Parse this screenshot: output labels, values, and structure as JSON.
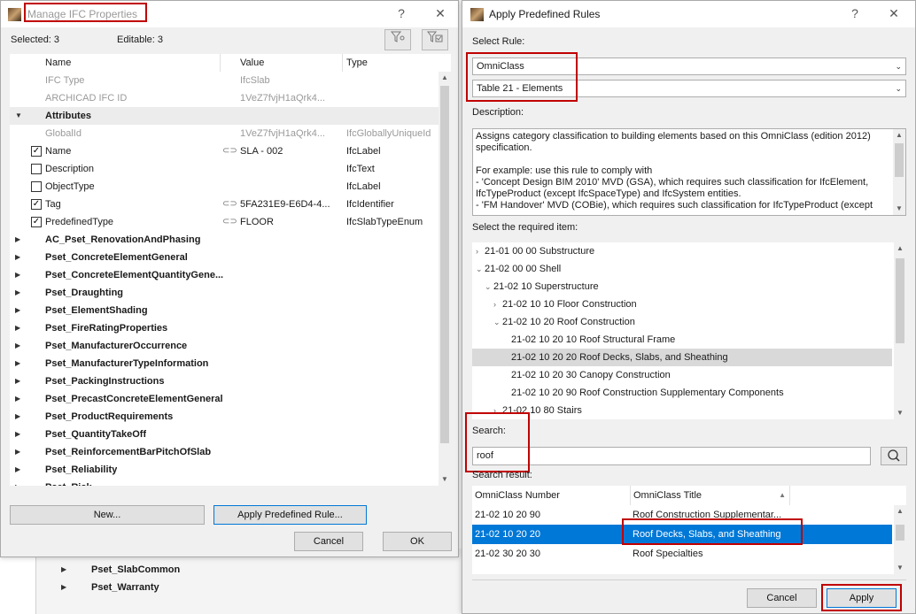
{
  "background_panel": {
    "rows": [
      "Pset_SlabCommon",
      "Pset_Warranty"
    ]
  },
  "left_dialog": {
    "title": "Manage IFC Properties",
    "help_label": "?",
    "close_label": "✕",
    "selected_label": "Selected: 3",
    "editable_label": "Editable: 3",
    "columns": {
      "name": "Name",
      "value": "Value",
      "type": "Type"
    },
    "top_rows": [
      {
        "name": "IFC Type",
        "value": "IfcSlab",
        "type": ""
      },
      {
        "name": "ARCHICAD IFC ID",
        "value": "1VeZ7fvjH1aQrk4...",
        "type": ""
      }
    ],
    "attributes_label": "Attributes",
    "attribute_rows": [
      {
        "name": "GlobalId",
        "value": "1VeZ7fvjH1aQrk4...",
        "type": "IfcGloballyUniqueId",
        "checked": null,
        "linked": false
      },
      {
        "name": "Name",
        "value": "SLA - 002",
        "type": "IfcLabel",
        "checked": true,
        "linked": true
      },
      {
        "name": "Description",
        "value": "",
        "type": "IfcText",
        "checked": false,
        "linked": false
      },
      {
        "name": "ObjectType",
        "value": "",
        "type": "IfcLabel",
        "checked": false,
        "linked": false
      },
      {
        "name": "Tag",
        "value": "5FA231E9-E6D4-4...",
        "type": "IfcIdentifier",
        "checked": true,
        "linked": true
      },
      {
        "name": "PredefinedType",
        "value": "FLOOR",
        "type": "IfcSlabTypeEnum",
        "checked": true,
        "linked": true
      }
    ],
    "psets": [
      "AC_Pset_RenovationAndPhasing",
      "Pset_ConcreteElementGeneral",
      "Pset_ConcreteElementQuantityGene...",
      "Pset_Draughting",
      "Pset_ElementShading",
      "Pset_FireRatingProperties",
      "Pset_ManufacturerOccurrence",
      "Pset_ManufacturerTypeInformation",
      "Pset_PackingInstructions",
      "Pset_PrecastConcreteElementGeneral",
      "Pset_ProductRequirements",
      "Pset_QuantityTakeOff",
      "Pset_ReinforcementBarPitchOfSlab",
      "Pset_Reliability",
      "Pset_Risk"
    ],
    "new_button": "New...",
    "apply_rule_button": "Apply Predefined Rule...",
    "cancel_button": "Cancel",
    "ok_button": "OK"
  },
  "right_dialog": {
    "title": "Apply Predefined Rules",
    "help_label": "?",
    "close_label": "✕",
    "select_rule_label": "Select Rule:",
    "rule_value": "OmniClass",
    "table_value": "Table 21 - Elements",
    "description_label": "Description:",
    "description_text": "Assigns category classification to building elements based on this OmniClass (edition 2012) specification.\n\nFor example: use this rule to comply with\n- 'Concept Design BIM 2010' MVD (GSA), which requires such classification for IfcElement, IfcTypeProduct (except IfcSpaceType) and IfcSystem entities.\n- 'FM Handover' MVD (COBie), which requires such classification for IfcTypeProduct (except",
    "required_item_label": "Select the required item:",
    "tree": [
      {
        "text": "21-01 00 00 Substructure",
        "indent": 0,
        "arrow": "›",
        "selected": false
      },
      {
        "text": "21-02 00 00 Shell",
        "indent": 0,
        "arrow": "⌄",
        "selected": false
      },
      {
        "text": "21-02 10 Superstructure",
        "indent": 1,
        "arrow": "⌄",
        "selected": false
      },
      {
        "text": "21-02 10 10 Floor Construction",
        "indent": 2,
        "arrow": "›",
        "selected": false
      },
      {
        "text": "21-02 10 20 Roof Construction",
        "indent": 2,
        "arrow": "⌄",
        "selected": false
      },
      {
        "text": "21-02 10 20 10 Roof Structural Frame",
        "indent": 3,
        "arrow": "",
        "selected": false
      },
      {
        "text": "21-02 10 20 20 Roof Decks, Slabs, and Sheathing",
        "indent": 3,
        "arrow": "",
        "selected": true
      },
      {
        "text": "21-02 10 20 30 Canopy Construction",
        "indent": 3,
        "arrow": "",
        "selected": false
      },
      {
        "text": "21-02 10 20 90 Roof Construction Supplementary Components",
        "indent": 3,
        "arrow": "",
        "selected": false
      },
      {
        "text": "21-02 10 80 Stairs",
        "indent": 2,
        "arrow": "›",
        "selected": false
      }
    ],
    "search_label": "Search:",
    "search_value": "roof",
    "search_result_label": "Search result:",
    "result_columns": {
      "number": "OmniClass Number",
      "title": "OmniClass Title"
    },
    "results": [
      {
        "number": "21-02 10 20 90",
        "title": "Roof Construction Supplementar...",
        "selected": false
      },
      {
        "number": "21-02 10 20 20",
        "title": "Roof Decks, Slabs, and Sheathing",
        "selected": true
      },
      {
        "number": "21-02 30 20 30",
        "title": "Roof Specialties",
        "selected": false
      }
    ],
    "cancel_button": "Cancel",
    "apply_button": "Apply"
  },
  "colors": {
    "highlight_red": "#c00000",
    "selection_blue": "#0078d7",
    "tree_selection": "#d9d9d9"
  }
}
